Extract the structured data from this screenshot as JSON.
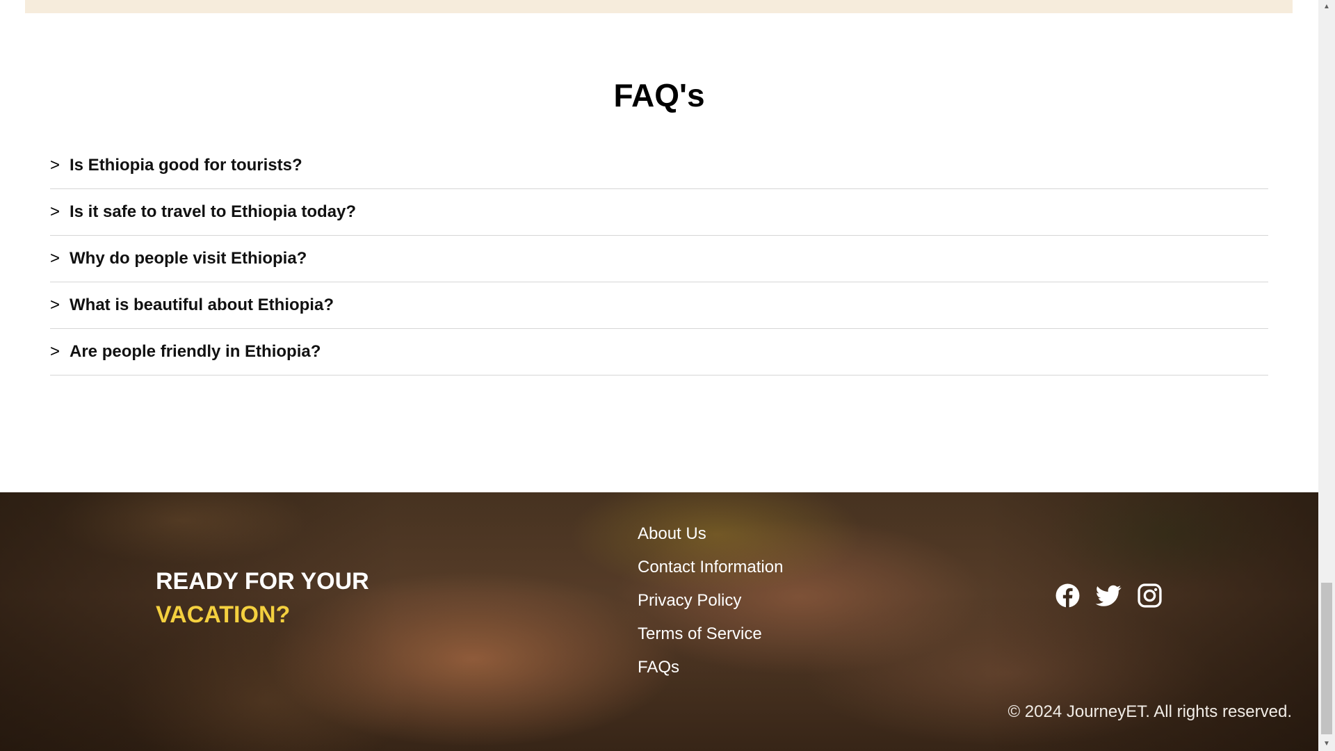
{
  "faq": {
    "title": "FAQ's",
    "chevron": ">",
    "items": [
      {
        "question": "Is Ethiopia good for tourists?"
      },
      {
        "question": "Is it safe to travel to Ethiopia today?"
      },
      {
        "question": "Why do people visit Ethiopia?"
      },
      {
        "question": "What is beautiful about Ethiopia?"
      },
      {
        "question": "Are people friendly in Ethiopia?"
      }
    ]
  },
  "footer": {
    "cta_line1": "READY FOR YOUR",
    "cta_line2": "VACATION?",
    "cta_accent_color": "#f4d03f",
    "links": [
      {
        "label": "About Us"
      },
      {
        "label": "Contact Information"
      },
      {
        "label": "Privacy Policy"
      },
      {
        "label": "Terms of Service"
      },
      {
        "label": "FAQs"
      }
    ],
    "social_icons": [
      "facebook-icon",
      "twitter-icon",
      "instagram-icon"
    ],
    "copyright": "© 2024 JourneyET. All rights reserved."
  },
  "scrollbar": {
    "up_arrow": "▲",
    "down_arrow": "▼"
  }
}
